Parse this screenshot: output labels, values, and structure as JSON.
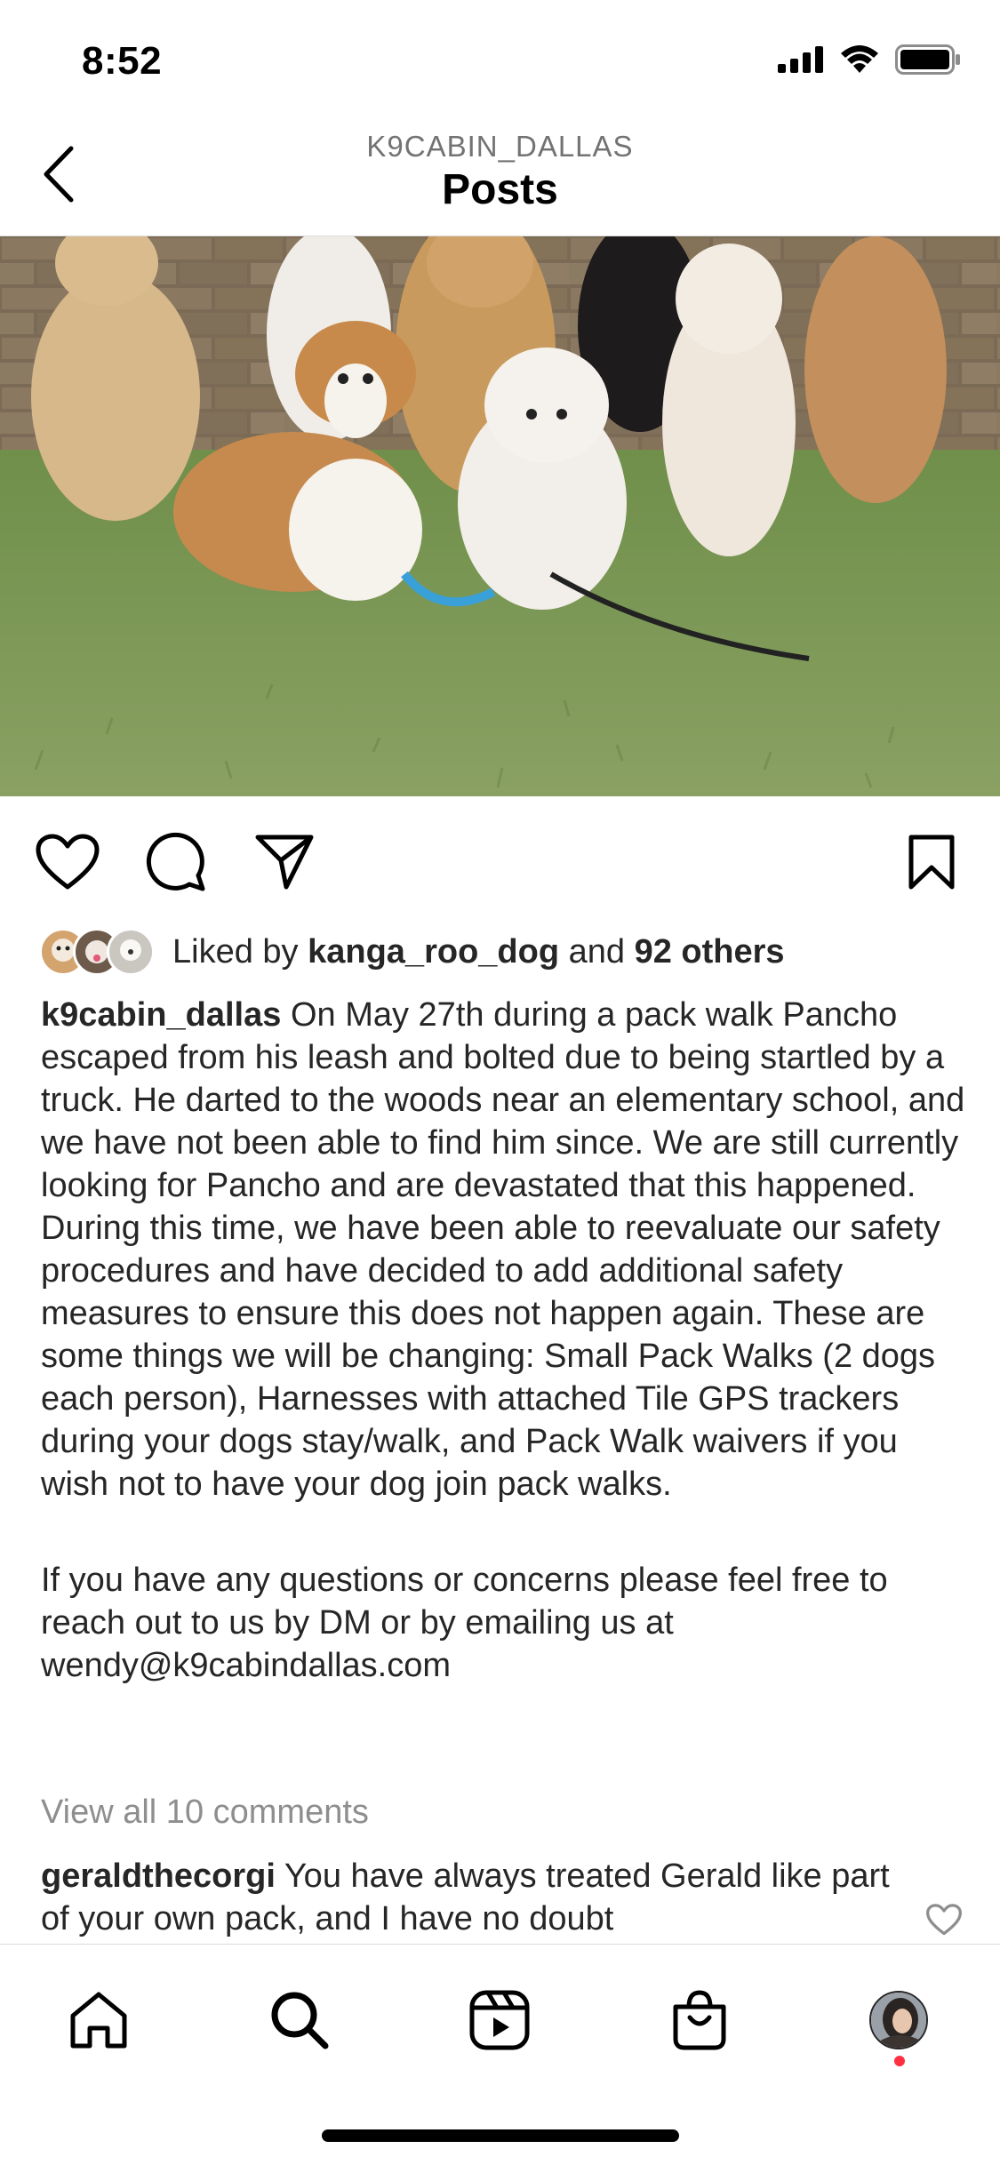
{
  "status_bar": {
    "time": "8:52"
  },
  "header": {
    "subtitle": "K9CABIN_DALLAS",
    "title": "Posts"
  },
  "post": {
    "image_alt": "Group of dogs sitting on grass in front of a brick wall",
    "likes": {
      "prefix": "Liked by",
      "user": "kanga_roo_dog",
      "middle": "and",
      "others": "92 others"
    },
    "caption": {
      "username": "k9cabin_dallas",
      "text_1": "On May 27th during a pack walk Pancho escaped from his leash and bolted due to being startled by a truck. He darted to the woods near an elementary school, and we have not been able to find him since. We are still currently looking for Pancho and are devastated that this happened. During this time, we have been able to reevaluate our safety procedures and have decided to add additional safety measures to ensure this does not happen again. These are some things we will be changing: Small Pack Walks (2 dogs each person), Harnesses with attached Tile GPS trackers during your dogs stay/walk, and Pack Walk waivers if you wish not to have your dog join pack walks.",
      "text_2": "If you have any questions or concerns please feel free to reach out to us by DM or by emailing us at wendy@k9cabindallas.com"
    },
    "view_comments": "View all 10 comments",
    "comment": {
      "username": "geraldthecorgi",
      "text": "You have always treated Gerald like part of your own pack, and I have no doubt"
    }
  },
  "icons": {
    "back": "chevron-left-icon",
    "like": "heart-icon",
    "comment": "speech-bubble-icon",
    "share": "paper-plane-icon",
    "save": "bookmark-icon",
    "home": "home-icon",
    "search": "search-icon",
    "reels": "reels-icon",
    "shop": "shopping-bag-icon"
  },
  "colors": {
    "text": "#262626",
    "muted": "#8e8e8e",
    "notification": "#ff3040"
  }
}
